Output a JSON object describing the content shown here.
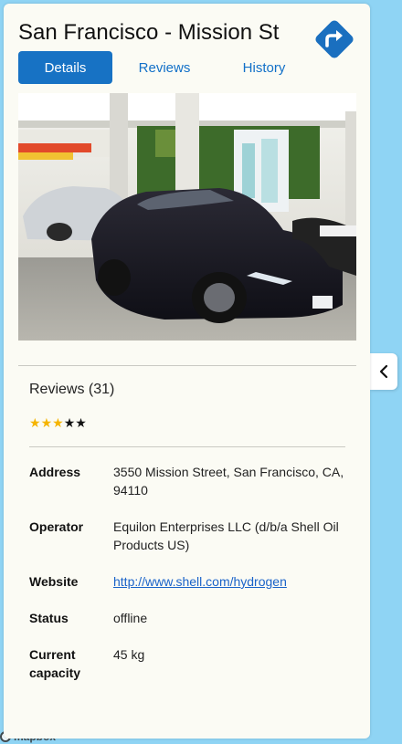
{
  "station": {
    "title": "San Francisco - Mission St"
  },
  "tabs": [
    {
      "label": "Details",
      "active": true
    },
    {
      "label": "Reviews",
      "active": false
    },
    {
      "label": "History",
      "active": false
    }
  ],
  "reviews": {
    "heading": "Reviews (31)",
    "rating": 3,
    "max_rating": 5
  },
  "details": {
    "address_label": "Address",
    "address_value": "3550 Mission Street, San Francisco, CA, 94110",
    "operator_label": "Operator",
    "operator_value": "Equilon Enterprises LLC (d/b/a Shell Oil Products US)",
    "website_label": "Website",
    "website_value": "http://www.shell.com/hydrogen",
    "status_label": "Status",
    "status_value": "offline",
    "capacity_label": "Current capacity",
    "capacity_value": "45 kg"
  },
  "map": {
    "attribution": "mapbox"
  },
  "icons": {
    "directions": "directions-icon",
    "collapse": "chevron-left-icon"
  },
  "colors": {
    "accent": "#1772c4",
    "directions": "#1a6fbf",
    "star_filled": "#f5b400",
    "link": "#1a63c9",
    "map_water": "#8fd4f4"
  }
}
